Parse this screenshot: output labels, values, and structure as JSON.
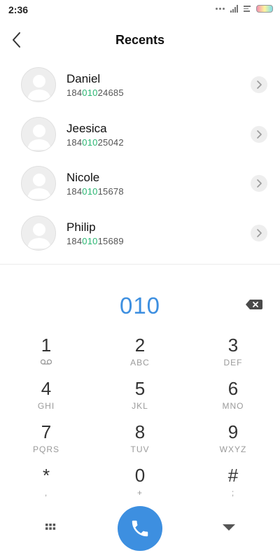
{
  "status_bar": {
    "time": "2:36"
  },
  "header": {
    "title": "Recents"
  },
  "contacts": [
    {
      "name": "Daniel",
      "number_prefix": "184",
      "number_match": "010",
      "number_suffix": "24685"
    },
    {
      "name": "Jeesica",
      "number_prefix": "184",
      "number_match": "010",
      "number_suffix": "25042"
    },
    {
      "name": "Nicole",
      "number_prefix": "184",
      "number_match": "010",
      "number_suffix": "15678"
    },
    {
      "name": "Philip",
      "number_prefix": "184",
      "number_match": "010",
      "number_suffix": "15689"
    }
  ],
  "dialer": {
    "value": "010"
  },
  "keypad": [
    {
      "digit": "1",
      "letters": "",
      "icon": "voicemail-icon"
    },
    {
      "digit": "2",
      "letters": "ABC"
    },
    {
      "digit": "3",
      "letters": "DEF"
    },
    {
      "digit": "4",
      "letters": "GHI"
    },
    {
      "digit": "5",
      "letters": "JKL"
    },
    {
      "digit": "6",
      "letters": "MNO"
    },
    {
      "digit": "7",
      "letters": "PQRS"
    },
    {
      "digit": "8",
      "letters": "TUV"
    },
    {
      "digit": "9",
      "letters": "WXYZ"
    },
    {
      "digit": "*",
      "letters": ","
    },
    {
      "digit": "0",
      "letters": "+"
    },
    {
      "digit": "#",
      "letters": ";"
    }
  ],
  "colors": {
    "accent": "#3d8fe0",
    "match_highlight": "#2bb673"
  },
  "icons": {
    "back": "chevron-left-icon",
    "detail": "chevron-right-icon",
    "backspace": "backspace-icon",
    "grid": "grid-icon",
    "call": "phone-icon",
    "collapse": "caret-down-icon"
  }
}
